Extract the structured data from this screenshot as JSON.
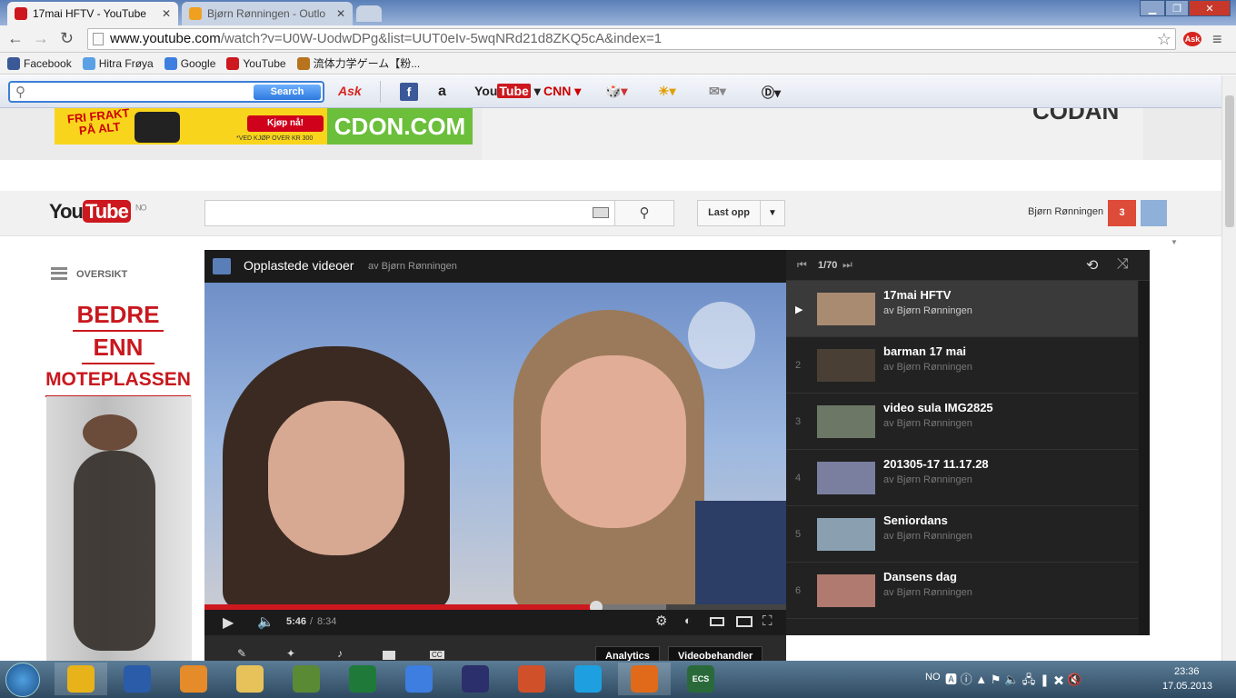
{
  "browser": {
    "tabs": [
      {
        "title": "17mai HFTV - YouTube",
        "active": true
      },
      {
        "title": "Bjørn Rønningen - Outlo",
        "active": false
      },
      {
        "title": "",
        "active": false
      }
    ],
    "url": {
      "host": "www.youtube.com",
      "path": "/watch?v=U0W-UodwDPg&list=UUT0eIv-5wqNRd21d8ZKQ5cA&index=1"
    },
    "bookmarks": [
      "Facebook",
      "Hitra Frøya",
      "Google",
      "YouTube",
      "流体力学ゲーム【粉..."
    ]
  },
  "ask_toolbar": {
    "search_button": "Search",
    "icons": [
      "ask-icon",
      "facebook-icon",
      "amazon-icon",
      "youtube-icon",
      "cnn-icon",
      "games-icon",
      "weather-icon",
      "mail-icon",
      "dictionary-icon"
    ]
  },
  "ads": {
    "left_top": "FRI FRAKT PÅ ALT",
    "left_cta": "Kjøp nå!",
    "left_note": "*VED KJØP OVER KR 300",
    "brand": "CDON.COM",
    "right_brand": "CODAN"
  },
  "youtube": {
    "logo_you": "You",
    "logo_tube": "Tube",
    "country": "NO",
    "upload_button": "Last opp",
    "user_name": "Bjørn Rønningen",
    "notification_count": "3",
    "sidebar_label": "OVERSIKT",
    "sidebar_ad": [
      "BEDRE",
      "ENN",
      "MOTEPLASSEN"
    ]
  },
  "player": {
    "playlist_title": "Opplastede videoer",
    "playlist_author": "av Bjørn Rønningen",
    "current_time": "5:46",
    "duration": "8:34",
    "progress_fraction": 0.673,
    "buttons": [
      "Analytics",
      "Videobehandler"
    ]
  },
  "playlist": {
    "position": "1/70",
    "items": [
      {
        "num": "▶",
        "title": "17mai HFTV",
        "author": "av Bjørn Rønningen",
        "active": true
      },
      {
        "num": "2",
        "title": "barman 17 mai",
        "author": "av Bjørn Rønningen"
      },
      {
        "num": "3",
        "title": "video sula IMG2825",
        "author": "av Bjørn Rønningen"
      },
      {
        "num": "4",
        "title": "201305-17 11.17.28",
        "author": "av Bjørn Rønningen"
      },
      {
        "num": "5",
        "title": "Seniordans",
        "author": "av Bjørn Rønningen"
      },
      {
        "num": "6",
        "title": "Dansens dag",
        "author": "av Bjørn Rønningen"
      }
    ]
  },
  "taskbar": {
    "apps": [
      "chrome-icon",
      "word-icon",
      "media-player-icon",
      "explorer-icon",
      "minecraft-icon",
      "excel-icon",
      "google-icon",
      "stellarium-icon",
      "powerpoint-icon",
      "skype-icon",
      "firefox-icon",
      "ecs-icon"
    ],
    "ecs_label": "ECS",
    "lang": "NO",
    "time": "23:36",
    "date": "17.05.2013"
  },
  "colors": {
    "youtube_red": "#cc181e",
    "progress_red": "#cc181e",
    "ask_blue": "#2c79de",
    "cdon_green": "#6bbf3b"
  }
}
